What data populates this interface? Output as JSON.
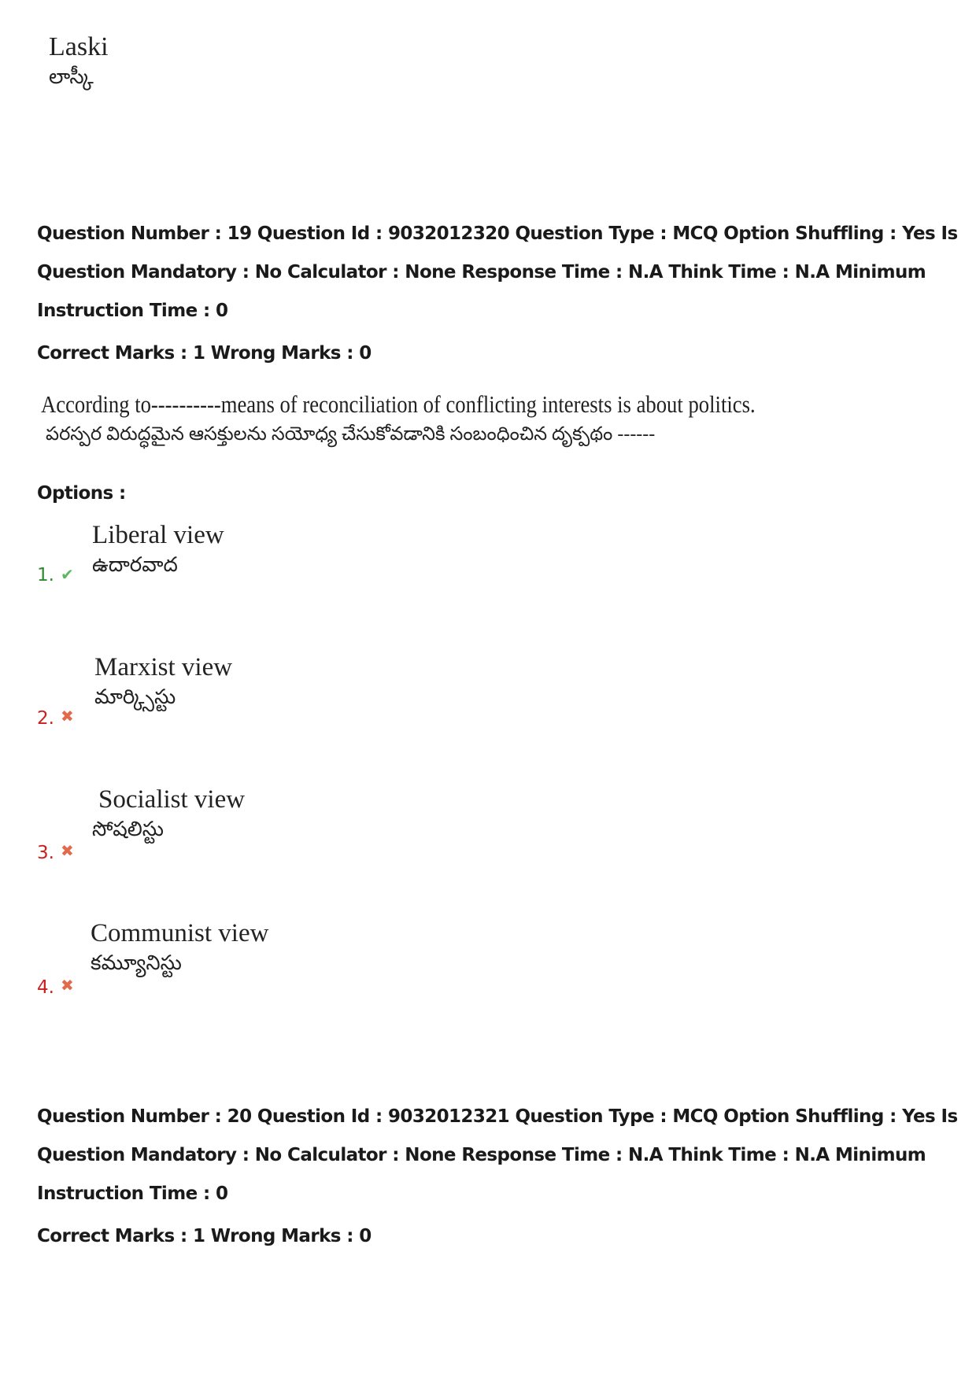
{
  "previous_question_tail": {
    "option_text_en": "Laski",
    "option_text_te": "లాస్కీ"
  },
  "question_19": {
    "meta_lines": [
      "Question Number : 19 Question Id : 9032012320 Question Type : MCQ Option Shuffling : Yes Is",
      "Question Mandatory : No Calculator : None Response Time : N.A Think Time : N.A Minimum",
      "Instruction Time : 0"
    ],
    "marks": "Correct Marks : 1 Wrong Marks : 0",
    "question_en": "According to----------means of reconciliation of conflicting interests is about politics.",
    "question_te": "పరస్పర విరుద్ధమైన ఆసక్తులను సయోధ్య చేసుకోవడానికి సంబంధించిన దృక్పథం ------",
    "options_label": "Options :",
    "options": [
      {
        "number": "1.",
        "status": "correct",
        "icon": "check-icon",
        "text_en": "Liberal view",
        "text_te": "ఉదారవాద"
      },
      {
        "number": "2.",
        "status": "wrong",
        "icon": "cross-icon",
        "text_en": "Marxist view",
        "text_te": "మార్క్సిస్టు"
      },
      {
        "number": "3.",
        "status": "wrong",
        "icon": "cross-icon",
        "text_en": "Socialist view",
        "text_te": "సోషలిస్టు"
      },
      {
        "number": "4.",
        "status": "wrong",
        "icon": "cross-icon",
        "text_en": "Communist view",
        "text_te": "కమ్యూనిస్టు"
      }
    ]
  },
  "question_20": {
    "meta_lines": [
      "Question Number : 20 Question Id : 9032012321 Question Type : MCQ Option Shuffling : Yes Is",
      "Question Mandatory : No Calculator : None Response Time : N.A Think Time : N.A Minimum",
      "Instruction Time : 0"
    ],
    "marks": "Correct Marks : 1 Wrong Marks : 0"
  },
  "icons": {
    "check": "✔",
    "cross": "✖"
  },
  "colors": {
    "correct": "#2e8b2e",
    "wrong": "#cc1f1f"
  }
}
